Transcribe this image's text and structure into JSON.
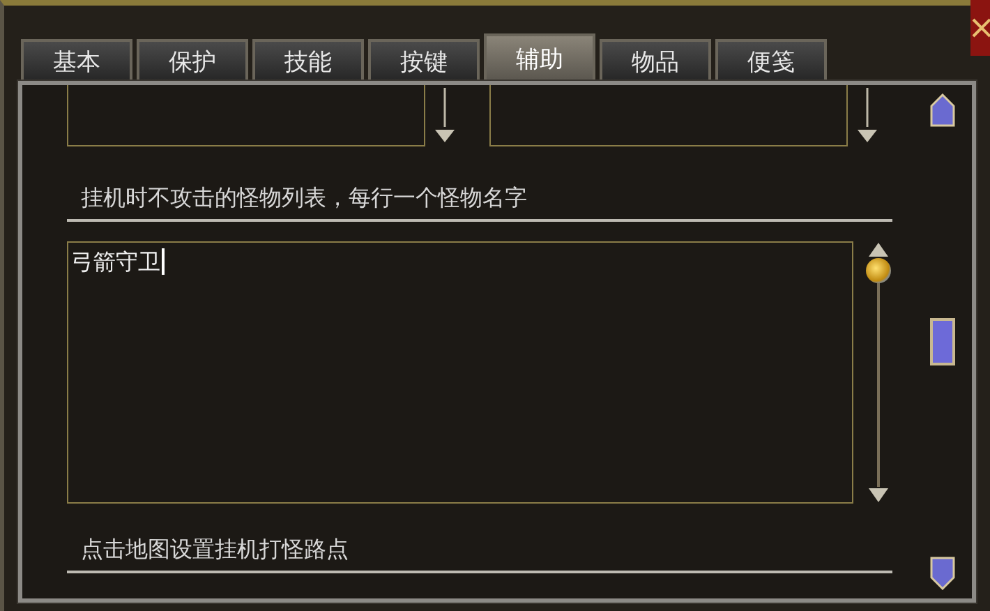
{
  "tabs": [
    {
      "label": "基本",
      "selected": false
    },
    {
      "label": "保护",
      "selected": false
    },
    {
      "label": "技能",
      "selected": false
    },
    {
      "label": "按键",
      "selected": false
    },
    {
      "label": "辅助",
      "selected": true
    },
    {
      "label": "物品",
      "selected": false
    },
    {
      "label": "便笺",
      "selected": false
    }
  ],
  "dropdowns": [
    {
      "kind": "select"
    },
    {
      "kind": "select"
    }
  ],
  "monster_list": {
    "label": "挂机时不攻击的怪物列表，每行一个怪物名字",
    "value": "弓箭守卫"
  },
  "route_label": "点击地图设置挂机打怪路点"
}
